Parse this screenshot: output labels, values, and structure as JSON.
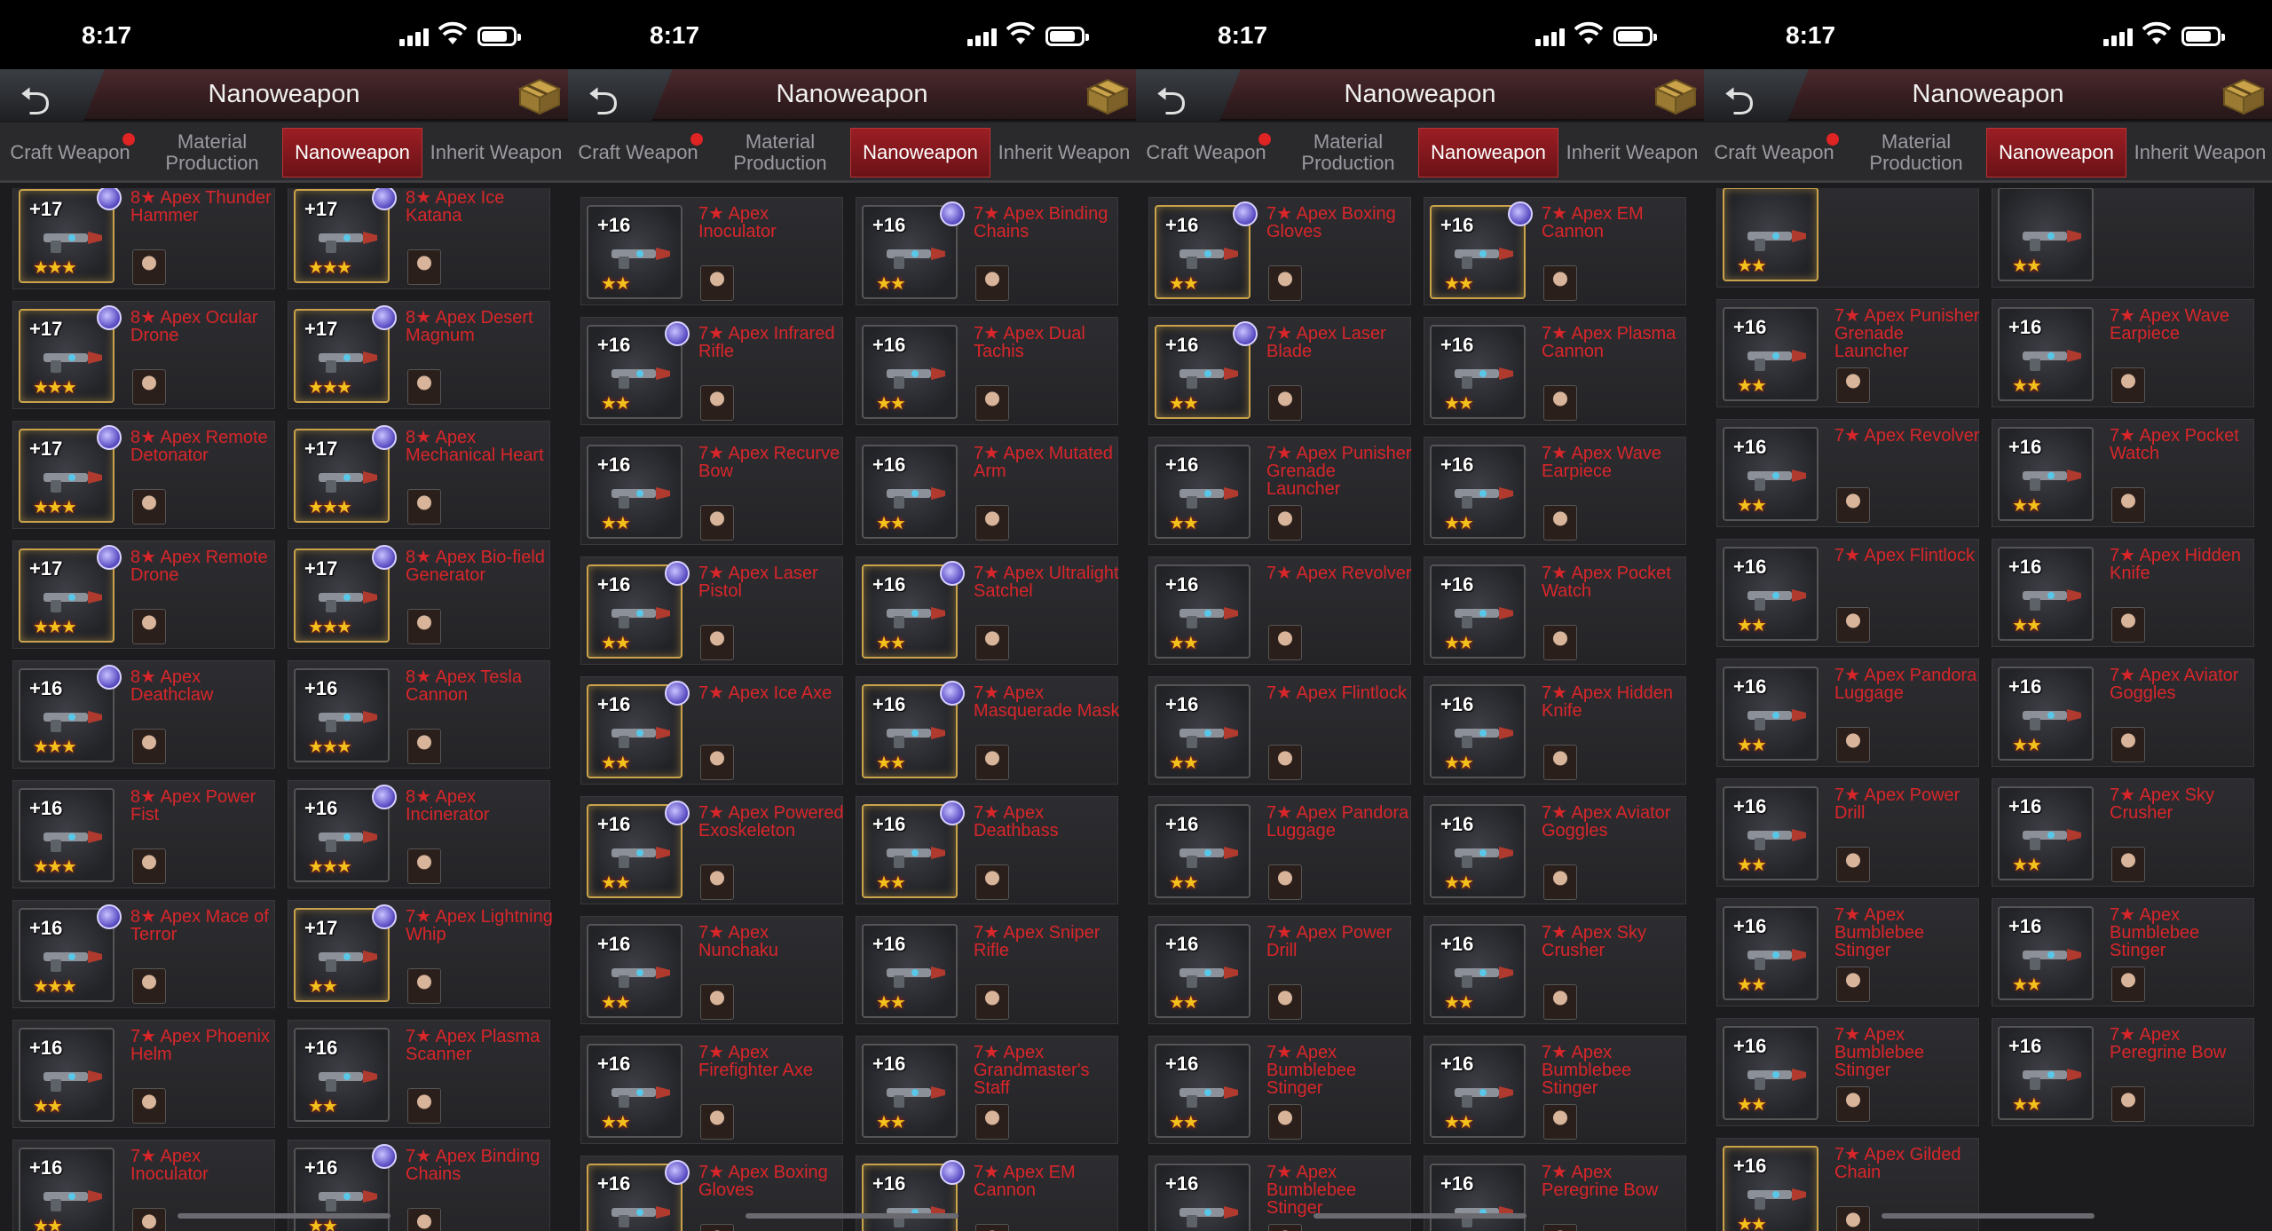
{
  "status_time": "8:17",
  "header_title": "Nanoweapon",
  "tabs": {
    "craft": "Craft Weapon",
    "material": "Material Production",
    "nano": "Nanoweapon",
    "inherit": "Inherit Weapon"
  },
  "colors": {
    "accent": "#9b1e24",
    "item_name": "#d8262a",
    "star": "#f2c21c",
    "badge_dot": "#e02323"
  },
  "icons": [
    "back-arrow-icon",
    "chest-icon",
    "signal-icon",
    "wifi-icon",
    "battery-icon"
  ],
  "screens": [
    {
      "items": [
        {
          "lvl": "+17",
          "stars": "★★★",
          "name": "8★ Apex Thunder Hammer",
          "orb": true,
          "gold": true
        },
        {
          "lvl": "+17",
          "stars": "★★★",
          "name": "8★ Apex Ice Katana",
          "orb": true,
          "gold": true
        },
        {
          "lvl": "+17",
          "stars": "★★★",
          "name": "8★ Apex Ocular Drone",
          "orb": true,
          "gold": true
        },
        {
          "lvl": "+17",
          "stars": "★★★",
          "name": "8★ Apex Desert Magnum",
          "orb": true,
          "gold": true
        },
        {
          "lvl": "+17",
          "stars": "★★★",
          "name": "8★ Apex Remote Detonator",
          "orb": true,
          "gold": true
        },
        {
          "lvl": "+17",
          "stars": "★★★",
          "name": "8★ Apex Mechanical Heart",
          "orb": true,
          "gold": true
        },
        {
          "lvl": "+17",
          "stars": "★★★",
          "name": "8★ Apex Remote Drone",
          "orb": true,
          "gold": true
        },
        {
          "lvl": "+17",
          "stars": "★★★",
          "name": "8★ Apex Bio-field Generator",
          "orb": true,
          "gold": true
        },
        {
          "lvl": "+16",
          "stars": "★★★",
          "name": "8★ Apex Deathclaw",
          "orb": true,
          "gold": false
        },
        {
          "lvl": "+16",
          "stars": "★★★",
          "name": "8★ Apex Tesla Cannon",
          "orb": false,
          "gold": false
        },
        {
          "lvl": "+16",
          "stars": "★★★",
          "name": "8★ Apex Power Fist",
          "orb": false,
          "gold": false
        },
        {
          "lvl": "+16",
          "stars": "★★★",
          "name": "8★ Apex Incinerator",
          "orb": true,
          "gold": false
        },
        {
          "lvl": "+16",
          "stars": "★★★",
          "name": "8★ Apex Mace of Terror",
          "orb": true,
          "gold": false
        },
        {
          "lvl": "+17",
          "stars": "★★",
          "name": "7★ Apex Lightning Whip",
          "orb": true,
          "gold": true
        },
        {
          "lvl": "+16",
          "stars": "★★",
          "name": "7★ Apex Phoenix Helm",
          "orb": false,
          "gold": false
        },
        {
          "lvl": "+16",
          "stars": "★★",
          "name": "7★ Apex Plasma Scanner",
          "orb": false,
          "gold": false
        },
        {
          "lvl": "+16",
          "stars": "★★",
          "name": "7★ Apex Inoculator",
          "orb": false,
          "gold": false
        },
        {
          "lvl": "+16",
          "stars": "★★",
          "name": "7★ Apex Binding Chains",
          "orb": true,
          "gold": false
        }
      ]
    },
    {
      "items": [
        {
          "lvl": "+16",
          "stars": "★★",
          "name": "7★ Apex Inoculator",
          "orb": false,
          "gold": false
        },
        {
          "lvl": "+16",
          "stars": "★★",
          "name": "7★ Apex Binding Chains",
          "orb": true,
          "gold": false
        },
        {
          "lvl": "+16",
          "stars": "★★",
          "name": "7★ Apex Infrared Rifle",
          "orb": true,
          "gold": false
        },
        {
          "lvl": "+16",
          "stars": "★★",
          "name": "7★ Apex Dual Tachis",
          "orb": false,
          "gold": false
        },
        {
          "lvl": "+16",
          "stars": "★★",
          "name": "7★ Apex Recurve Bow",
          "orb": false,
          "gold": false
        },
        {
          "lvl": "+16",
          "stars": "★★",
          "name": "7★ Apex Mutated Arm",
          "orb": false,
          "gold": false
        },
        {
          "lvl": "+16",
          "stars": "★★",
          "name": "7★ Apex Laser Pistol",
          "orb": true,
          "gold": true
        },
        {
          "lvl": "+16",
          "stars": "★★",
          "name": "7★ Apex Ultralight Satchel",
          "orb": true,
          "gold": true
        },
        {
          "lvl": "+16",
          "stars": "★★",
          "name": "7★ Apex Ice Axe",
          "orb": true,
          "gold": true
        },
        {
          "lvl": "+16",
          "stars": "★★",
          "name": "7★ Apex Masquerade Mask",
          "orb": true,
          "gold": true
        },
        {
          "lvl": "+16",
          "stars": "★★",
          "name": "7★ Apex Powered Exoskeleton",
          "orb": true,
          "gold": true
        },
        {
          "lvl": "+16",
          "stars": "★★",
          "name": "7★ Apex Deathbass",
          "orb": true,
          "gold": true
        },
        {
          "lvl": "+16",
          "stars": "★★",
          "name": "7★ Apex Nunchaku",
          "orb": false,
          "gold": false
        },
        {
          "lvl": "+16",
          "stars": "★★",
          "name": "7★ Apex Sniper Rifle",
          "orb": false,
          "gold": false
        },
        {
          "lvl": "+16",
          "stars": "★★",
          "name": "7★ Apex Firefighter Axe",
          "orb": false,
          "gold": false
        },
        {
          "lvl": "+16",
          "stars": "★★",
          "name": "7★ Apex Grandmaster's Staff",
          "orb": false,
          "gold": false
        },
        {
          "lvl": "+16",
          "stars": "★★",
          "name": "7★ Apex Boxing Gloves",
          "orb": true,
          "gold": true
        },
        {
          "lvl": "+16",
          "stars": "★★",
          "name": "7★ Apex EM Cannon",
          "orb": true,
          "gold": true
        }
      ]
    },
    {
      "items": [
        {
          "lvl": "+16",
          "stars": "★★",
          "name": "7★ Apex Boxing Gloves",
          "orb": true,
          "gold": true
        },
        {
          "lvl": "+16",
          "stars": "★★",
          "name": "7★ Apex EM Cannon",
          "orb": true,
          "gold": true
        },
        {
          "lvl": "+16",
          "stars": "★★",
          "name": "7★ Apex Laser Blade",
          "orb": true,
          "gold": true
        },
        {
          "lvl": "+16",
          "stars": "★★",
          "name": "7★ Apex Plasma Cannon",
          "orb": false,
          "gold": false
        },
        {
          "lvl": "+16",
          "stars": "★★",
          "name": "7★ Apex Punisher Grenade Launcher",
          "orb": false,
          "gold": false
        },
        {
          "lvl": "+16",
          "stars": "★★",
          "name": "7★ Apex Wave Earpiece",
          "orb": false,
          "gold": false
        },
        {
          "lvl": "+16",
          "stars": "★★",
          "name": "7★ Apex Revolver",
          "orb": false,
          "gold": false
        },
        {
          "lvl": "+16",
          "stars": "★★",
          "name": "7★ Apex Pocket Watch",
          "orb": false,
          "gold": false
        },
        {
          "lvl": "+16",
          "stars": "★★",
          "name": "7★ Apex Flintlock",
          "orb": false,
          "gold": false
        },
        {
          "lvl": "+16",
          "stars": "★★",
          "name": "7★ Apex Hidden Knife",
          "orb": false,
          "gold": false
        },
        {
          "lvl": "+16",
          "stars": "★★",
          "name": "7★ Apex Pandora Luggage",
          "orb": false,
          "gold": false
        },
        {
          "lvl": "+16",
          "stars": "★★",
          "name": "7★ Apex Aviator Goggles",
          "orb": false,
          "gold": false
        },
        {
          "lvl": "+16",
          "stars": "★★",
          "name": "7★ Apex Power Drill",
          "orb": false,
          "gold": false
        },
        {
          "lvl": "+16",
          "stars": "★★",
          "name": "7★ Apex Sky Crusher",
          "orb": false,
          "gold": false
        },
        {
          "lvl": "+16",
          "stars": "★★",
          "name": "7★ Apex Bumblebee Stinger",
          "orb": false,
          "gold": false
        },
        {
          "lvl": "+16",
          "stars": "★★",
          "name": "7★ Apex Bumblebee Stinger",
          "orb": false,
          "gold": false
        },
        {
          "lvl": "+16",
          "stars": "★★",
          "name": "7★ Apex Bumblebee Stinger",
          "orb": false,
          "gold": false
        },
        {
          "lvl": "+16",
          "stars": "★★",
          "name": "7★ Apex Peregrine Bow",
          "orb": false,
          "gold": false
        }
      ]
    },
    {
      "items": [
        {
          "lvl": "",
          "stars": "★★",
          "name": "",
          "orb": false,
          "gold": true
        },
        {
          "lvl": "",
          "stars": "★★",
          "name": "",
          "orb": false,
          "gold": false
        },
        {
          "lvl": "+16",
          "stars": "★★",
          "name": "7★ Apex Punisher Grenade Launcher",
          "orb": false,
          "gold": false
        },
        {
          "lvl": "+16",
          "stars": "★★",
          "name": "7★ Apex Wave Earpiece",
          "orb": false,
          "gold": false
        },
        {
          "lvl": "+16",
          "stars": "★★",
          "name": "7★ Apex Revolver",
          "orb": false,
          "gold": false
        },
        {
          "lvl": "+16",
          "stars": "★★",
          "name": "7★ Apex Pocket Watch",
          "orb": false,
          "gold": false
        },
        {
          "lvl": "+16",
          "stars": "★★",
          "name": "7★ Apex Flintlock",
          "orb": false,
          "gold": false
        },
        {
          "lvl": "+16",
          "stars": "★★",
          "name": "7★ Apex Hidden Knife",
          "orb": false,
          "gold": false
        },
        {
          "lvl": "+16",
          "stars": "★★",
          "name": "7★ Apex Pandora Luggage",
          "orb": false,
          "gold": false
        },
        {
          "lvl": "+16",
          "stars": "★★",
          "name": "7★ Apex Aviator Goggles",
          "orb": false,
          "gold": false
        },
        {
          "lvl": "+16",
          "stars": "★★",
          "name": "7★ Apex Power Drill",
          "orb": false,
          "gold": false
        },
        {
          "lvl": "+16",
          "stars": "★★",
          "name": "7★ Apex Sky Crusher",
          "orb": false,
          "gold": false
        },
        {
          "lvl": "+16",
          "stars": "★★",
          "name": "7★ Apex Bumblebee Stinger",
          "orb": false,
          "gold": false
        },
        {
          "lvl": "+16",
          "stars": "★★",
          "name": "7★ Apex Bumblebee Stinger",
          "orb": false,
          "gold": false
        },
        {
          "lvl": "+16",
          "stars": "★★",
          "name": "7★ Apex Bumblebee Stinger",
          "orb": false,
          "gold": false
        },
        {
          "lvl": "+16",
          "stars": "★★",
          "name": "7★ Apex Peregrine Bow",
          "orb": false,
          "gold": false
        },
        {
          "lvl": "+16",
          "stars": "★★",
          "name": "7★ Apex Gilded Chain",
          "orb": false,
          "gold": true
        }
      ]
    }
  ]
}
